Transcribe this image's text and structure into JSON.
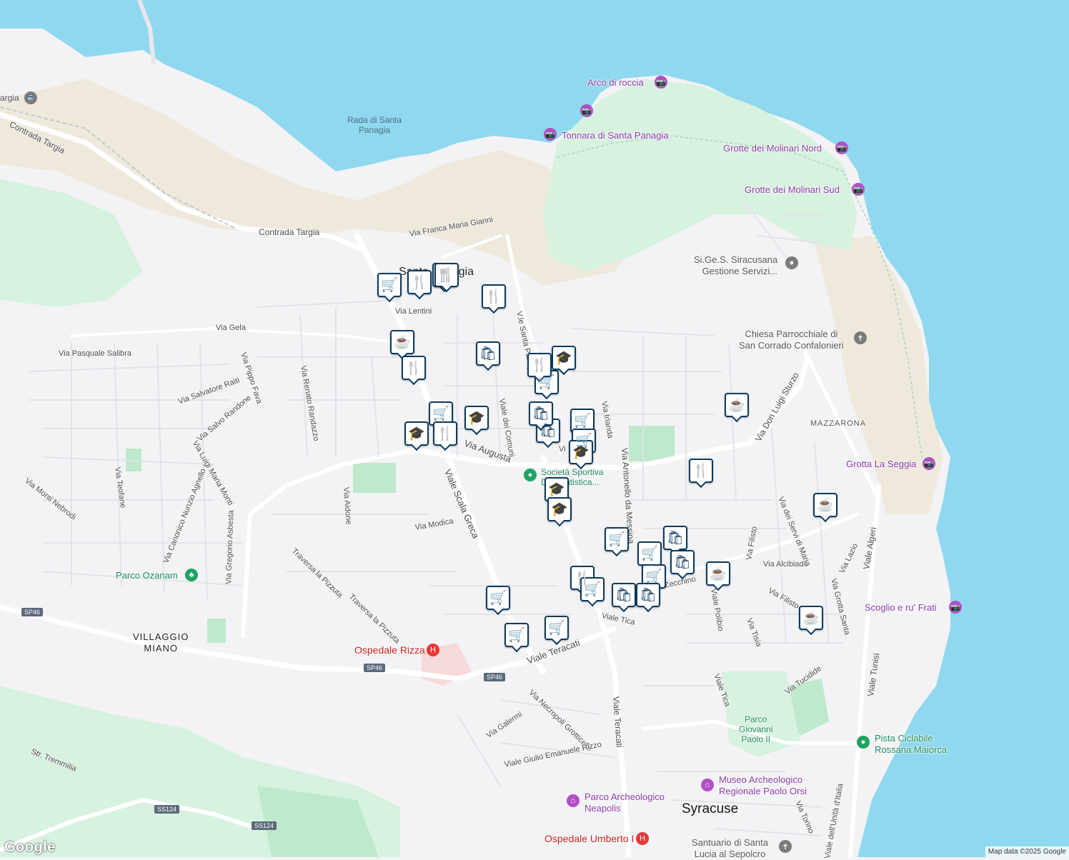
{
  "colors": {
    "sea": "#8fd8f0",
    "land": "#f3f3f5",
    "park": "#cfeedb",
    "sand": "#efe9dc",
    "pin_border": "#0b3a5f",
    "road": "#ffffff"
  },
  "water_labels": {
    "rada": "Rada di Santa\nPanagia"
  },
  "town_labels": {
    "villaggio_miano": "VILLAGGIO\nMIANO",
    "syracuse": "Syracuse",
    "mazzarona": "MAZZARONA",
    "santa_panagia": "Santa Panagia"
  },
  "poi": {
    "arco": "Arco di roccia",
    "tonnara": "Tonnara di Santa Panagia",
    "grotte_nord": "Grotte dei Molinari Nord",
    "grotte_sud": "Grotte dei Molinari Sud",
    "sigess": "Si.Ge.S. Siracusana\nGestione Servizi...",
    "chiesa": "Chiesa Parrocchiale di\nSan Corrado Confalonieri",
    "grotta_seggia": "Grotta La Seggia",
    "scoglio": "Scoglio e ru' Frati",
    "pista": "Pista Ciclabile\nRossana Maiorca",
    "museo": "Museo Archeologico\nRegionale Paolo Orsi",
    "parco_neapolis": "Parco Archeologico\nNeapolis",
    "ospedale_umberto": "Ospedale Umberto I",
    "santuario": "Santuario di Santa\nLucia al Sepolcro",
    "parco_ozanam": "Parco Ozanam",
    "ospedale_rizza": "Ospedale Rizza",
    "societa": "Società Sportiva\nDilettantistica...",
    "parco_giovanni": "Parco\nGiovanni\nPaolo II",
    "targia": "argia"
  },
  "streets": {
    "contrada_targia_1": "Contrada Targia",
    "contrada_targia_2": "Contrada Targia",
    "franca": "Via Franca Maria Gianni",
    "lentini": "Via Lentini",
    "gela": "Via Gela",
    "salibra": "Via Pasquale Salibra",
    "raiti": "Via Salvatore Raiti",
    "randone": "Via Salvo Randone",
    "fava": "Via Pippo Fava",
    "randazzo": "Via Renato Randazzo",
    "monti": "Via Luigi Maria Monti",
    "agnello": "Via Canonico Nunzio Agnello",
    "nebrodi": "Via Monti Nebrodi",
    "teofane": "Via Teofane",
    "asbesta": "Via Gregorio Asbesta",
    "aidone": "Via Aidone",
    "modica": "Via Modica",
    "scala_greca": "Viale Scala Greca",
    "augusta": "Via Augusta",
    "comuni": "Viale dei Comuni",
    "santa_panagia": "V.le Santa Panagia",
    "irlanda": "Via Irlanda",
    "messina": "Via Antonello da Messina",
    "sturzo": "Via Don Luigi Sturzo",
    "pizzuta1": "Traversa la Pizzuta",
    "pizzuta2": "Traversa la Pizzuta",
    "teracati": "Viale Teracati",
    "teracati_v": "Viale Teracati",
    "necropoli": "Via Necropoli Grotticelle",
    "galermi": "Via Galermi",
    "rizzo": "Viale Giulio Emanuele Rizzo",
    "tica": "Viale Tica",
    "tica2": "Viale Tica",
    "zecchino": "Zecchino",
    "polibio": "Viale Polibio",
    "tisia": "Via Tisia",
    "filisto": "Via Filisto",
    "filisto2": "Via Filisto",
    "alcibiade": "Via Alcibiade",
    "servi": "Via dei Servi di Maria",
    "grotta_santa": "Via Grotta Santa",
    "lazio": "Via Lazio",
    "algeri": "Viale Algeri",
    "tunisi": "Viale Tunisi",
    "tucidide": "Via Tucidide",
    "tremmilia": "Str. Tremmilia",
    "torino": "Via Torino",
    "unita": "Viale dell'Unità d'Italia",
    "via_v": "Vi"
  },
  "shields": {
    "sp46a": "SP46",
    "sp46b": "SP46",
    "sp46c": "SP46",
    "ss124a": "SS124",
    "ss124b": "SS124"
  },
  "icons": {
    "cart": "🛒",
    "fork": "🍴",
    "bag": "🛍",
    "cap": "🎓",
    "cup": "☕",
    "camera": "📷",
    "cross": "✝",
    "pin": "●",
    "h": "H",
    "tree": "♣",
    "museum": "⌂",
    "train": "🚆"
  },
  "markers": [
    {
      "type": "cart"
    },
    {
      "type": "fork"
    },
    {
      "type": "fork"
    },
    {
      "type": "fork"
    },
    {
      "type": "fork"
    },
    {
      "type": "bag"
    },
    {
      "type": "cup"
    },
    {
      "type": "fork"
    },
    {
      "type": "cart"
    },
    {
      "type": "cart"
    },
    {
      "type": "cap"
    },
    {
      "type": "fork"
    },
    {
      "type": "cap"
    },
    {
      "type": "fork"
    },
    {
      "type": "cap"
    },
    {
      "type": "cart"
    },
    {
      "type": "bag"
    },
    {
      "type": "cart"
    },
    {
      "type": "bag"
    },
    {
      "type": "cap"
    },
    {
      "type": "cap"
    },
    {
      "type": "cap"
    },
    {
      "type": "cup"
    },
    {
      "type": "fork"
    },
    {
      "type": "cup"
    },
    {
      "type": "cart"
    },
    {
      "type": "bag"
    },
    {
      "type": "cart"
    },
    {
      "type": "bag"
    },
    {
      "type": "cart"
    },
    {
      "type": "cup"
    },
    {
      "type": "fork"
    },
    {
      "type": "cart"
    },
    {
      "type": "bag"
    },
    {
      "type": "bag"
    },
    {
      "type": "cup"
    },
    {
      "type": "cart"
    },
    {
      "type": "cart"
    },
    {
      "type": "cart"
    }
  ],
  "attribution": "Map data ©2025 Google",
  "logo": "Google"
}
